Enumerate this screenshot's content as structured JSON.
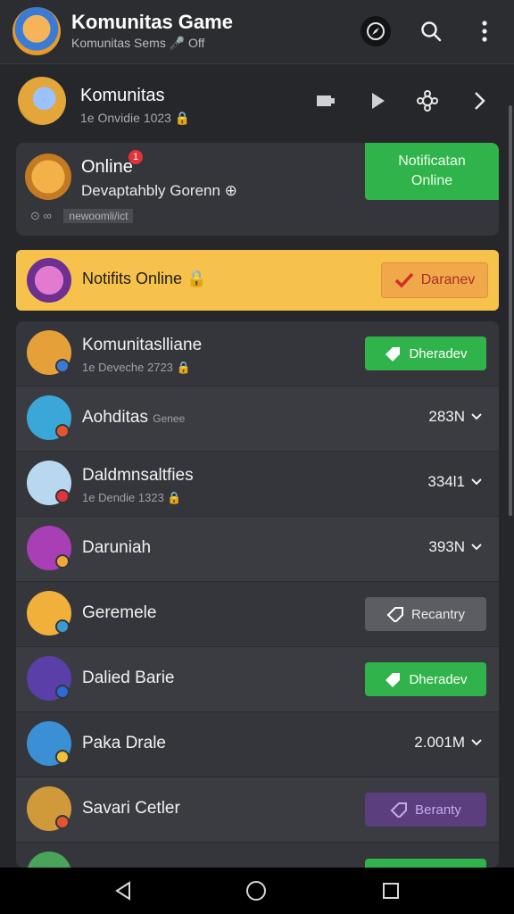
{
  "app": {
    "title": "Komunitas Game",
    "subtitle": "Komunitas Sems  🎤 Off",
    "icons": [
      "compass-icon",
      "search-icon",
      "more-vertical-icon"
    ]
  },
  "community": {
    "title": "Komunitas",
    "meta": "1e Onvidie 1023  🔒",
    "icons": [
      "display-icon",
      "play-icon",
      "settings-icon",
      "chevron-right-icon"
    ]
  },
  "online_card": {
    "title": "Online",
    "badge": "1",
    "subtitle": "Devaptahbly Gorenn ⊕",
    "meta_icons": "⊙ ∞",
    "tag": "newoomli/ict",
    "button": "Notificatan\nOnline"
  },
  "banner": {
    "text": "Notifits Online 🔒",
    "button": "Daranev"
  },
  "rows": [
    {
      "title": "Komunitaslliane",
      "sub": "1e Deveche 2723  🔒",
      "action": "Dheradev",
      "style": "green",
      "avatar": "#e6a03a",
      "dot": "#3a7bd5"
    },
    {
      "title": "Aohditas",
      "tag": "Genee",
      "count": "283N",
      "avatar": "#3ba7d8",
      "dot": "#e2552e"
    },
    {
      "title": "Daldmnsaltfies",
      "sub": "1e Dendie 1323  🔒",
      "count": "334l1",
      "avatar": "#b9d8f0",
      "dot": "#e2343a"
    },
    {
      "title": "Daruniah",
      "count": "393N",
      "avatar": "#a93fb5",
      "dot": "#f0a63a"
    },
    {
      "title": "Geremele",
      "action": "Recantry",
      "style": "grey",
      "avatar": "#f0b03a",
      "dot": "#3a9bd5"
    },
    {
      "title": "Dalied Barie",
      "action": "Dheradev",
      "style": "green",
      "avatar": "#5a3fa8",
      "dot": "#2a6bd5"
    },
    {
      "title": "Paka Drale",
      "count": "2.001M",
      "avatar": "#3a8fd5",
      "dot": "#f0c23a"
    },
    {
      "title": "Savari Cetler",
      "action": "Beranty",
      "style": "purple",
      "avatar": "#d09a3a",
      "dot": "#e2552e"
    }
  ],
  "nav": {
    "icons": [
      "back-icon",
      "home-icon",
      "recents-icon"
    ]
  }
}
